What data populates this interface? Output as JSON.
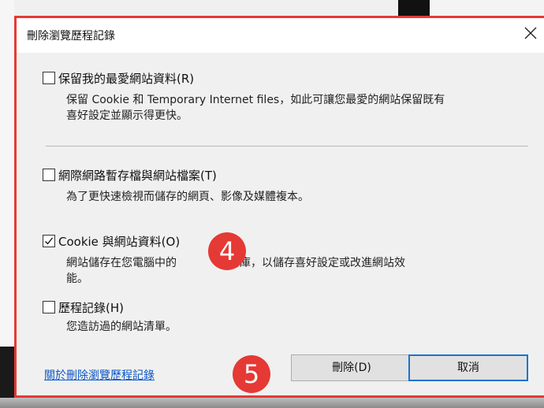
{
  "dialog": {
    "title": "刪除瀏覽歷程記錄"
  },
  "options": [
    {
      "label": "保留我的最愛網站資料(R)",
      "desc_lines": [
        "保留 Cookie 和 Temporary Internet files，如此可讓您最愛的網站保留既有",
        "喜好設定並顯示得更快。"
      ],
      "checked": false
    },
    {
      "label": "網際網路暫存檔與網站檔案(T)",
      "desc_lines": [
        "為了更快速檢視而儲存的網頁、影像及媒體複本。"
      ],
      "checked": false
    },
    {
      "label": "Cookie 與網站資料(O)",
      "desc_lines": [
        "網站儲存在您電腦中的",
        "資料庫，以儲存喜好設定或改進網站效",
        "能。"
      ],
      "checked": true
    },
    {
      "label": "歷程記錄(H)",
      "desc_lines": [
        "您造訪過的網站清單。"
      ],
      "checked": false
    }
  ],
  "footer": {
    "link": "關於刪除瀏覽歷程記錄",
    "delete_label": "刪除(D)",
    "cancel_label": "取消"
  },
  "annotations": {
    "step4": "4",
    "step5": "5"
  },
  "colors": {
    "annotation": "#e53935",
    "link": "#0b56c4",
    "focus_border": "#1873d3"
  }
}
